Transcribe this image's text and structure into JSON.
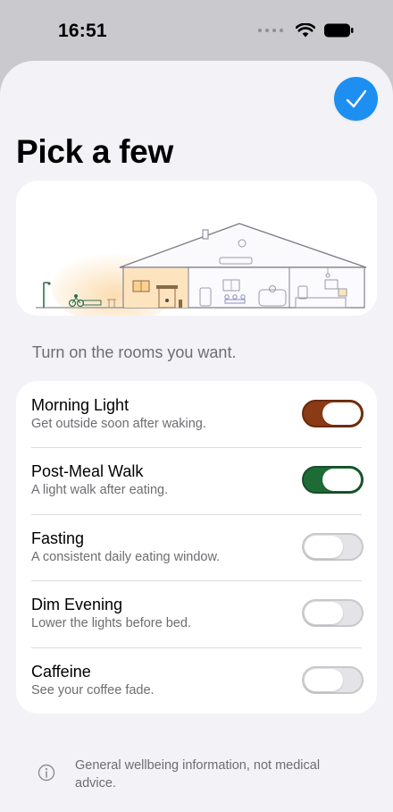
{
  "status": {
    "time": "16:51"
  },
  "header": {
    "title": "Pick a few"
  },
  "instructions": "Turn on the rooms you want.",
  "rooms": [
    {
      "title": "Morning Light",
      "subtitle": "Get outside soon after waking.",
      "on": true,
      "color": "#8a3a14"
    },
    {
      "title": "Post-Meal Walk",
      "subtitle": "A light walk after eating.",
      "on": true,
      "color": "#1e6b35"
    },
    {
      "title": "Fasting",
      "subtitle": "A consistent daily eating window.",
      "on": false
    },
    {
      "title": "Dim Evening",
      "subtitle": "Lower the lights before bed.",
      "on": false
    },
    {
      "title": "Caffeine",
      "subtitle": "See your coffee fade.",
      "on": false
    }
  ],
  "footer": {
    "text": "General wellbeing information, not medical advice."
  },
  "colors": {
    "accent": "#1c8ff0"
  }
}
